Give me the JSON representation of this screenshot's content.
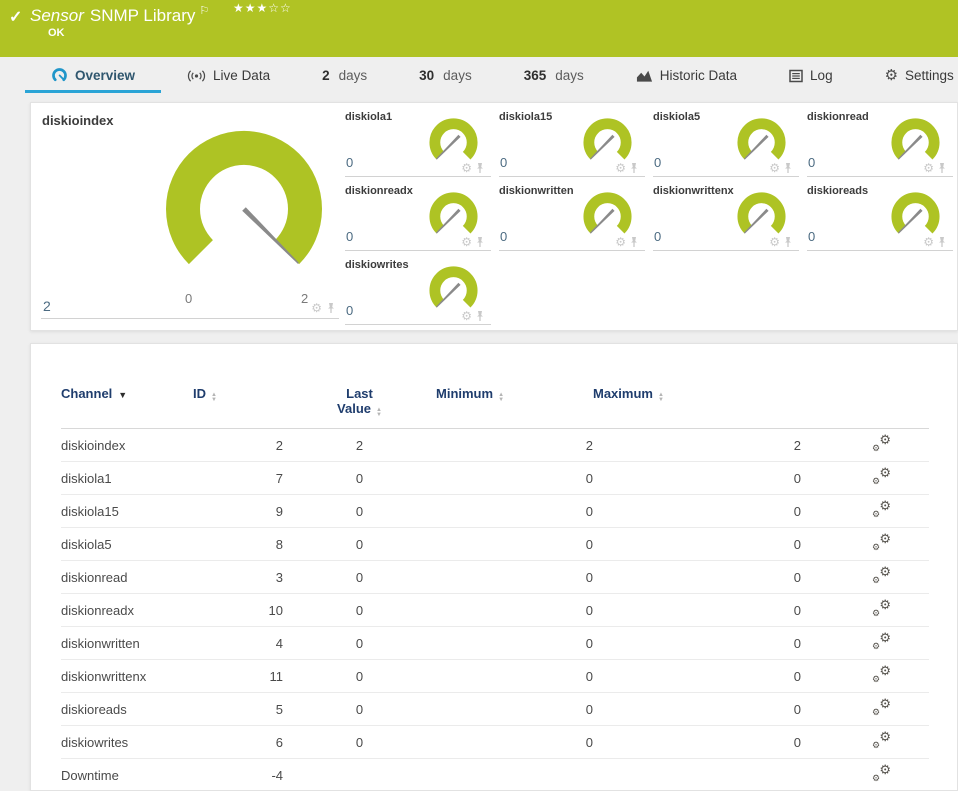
{
  "header": {
    "check_icon": "✓",
    "title_prefix": "Sensor",
    "title": "SNMP Library",
    "status": "OK",
    "flag_icon": "⚐",
    "stars_filled": "★★★",
    "stars_empty": "☆☆",
    "background_color": "#b0c324"
  },
  "tabs": {
    "overview": "Overview",
    "live_data": "Live Data",
    "d2_num": "2",
    "d2_unit": "days",
    "d30_num": "30",
    "d30_unit": "days",
    "d365_num": "365",
    "d365_unit": "days",
    "historic": "Historic Data",
    "log": "Log",
    "settings": "Settings",
    "active_tab": "Overview",
    "active_underline_color": "#2aa4d6"
  },
  "icons": {
    "gear": "⚙",
    "sort_up": "▲",
    "sort_down": "▼"
  },
  "gauges": {
    "accent_color": "#aec324",
    "needle_color": "#8a8a8a",
    "large": {
      "title": "diskioindex",
      "value": "2",
      "scale_min": "0",
      "scale_max": "2"
    },
    "small": [
      {
        "title": "diskiola1",
        "value": "0"
      },
      {
        "title": "diskiola15",
        "value": "0"
      },
      {
        "title": "diskiola5",
        "value": "0"
      },
      {
        "title": "diskionread",
        "value": "0"
      },
      {
        "title": "diskionreadx",
        "value": "0"
      },
      {
        "title": "diskionwritten",
        "value": "0"
      },
      {
        "title": "diskionwrittenx",
        "value": "0"
      },
      {
        "title": "diskioreads",
        "value": "0"
      },
      {
        "title": "diskiowrites",
        "value": "0"
      }
    ]
  },
  "table": {
    "headers": {
      "channel": "Channel",
      "id": "ID",
      "last_value": "Last Value",
      "minimum": "Minimum",
      "maximum": "Maximum"
    },
    "rows": [
      {
        "channel": "diskioindex",
        "id": "2",
        "last": "2",
        "min": "2",
        "max": "2"
      },
      {
        "channel": "diskiola1",
        "id": "7",
        "last": "0",
        "min": "0",
        "max": "0"
      },
      {
        "channel": "diskiola15",
        "id": "9",
        "last": "0",
        "min": "0",
        "max": "0"
      },
      {
        "channel": "diskiola5",
        "id": "8",
        "last": "0",
        "min": "0",
        "max": "0"
      },
      {
        "channel": "diskionread",
        "id": "3",
        "last": "0",
        "min": "0",
        "max": "0"
      },
      {
        "channel": "diskionreadx",
        "id": "10",
        "last": "0",
        "min": "0",
        "max": "0"
      },
      {
        "channel": "diskionwritten",
        "id": "4",
        "last": "0",
        "min": "0",
        "max": "0"
      },
      {
        "channel": "diskionwrittenx",
        "id": "11",
        "last": "0",
        "min": "0",
        "max": "0"
      },
      {
        "channel": "diskioreads",
        "id": "5",
        "last": "0",
        "min": "0",
        "max": "0"
      },
      {
        "channel": "diskiowrites",
        "id": "6",
        "last": "0",
        "min": "0",
        "max": "0"
      },
      {
        "channel": "Downtime",
        "id": "-4",
        "last": "",
        "min": "",
        "max": ""
      }
    ]
  }
}
